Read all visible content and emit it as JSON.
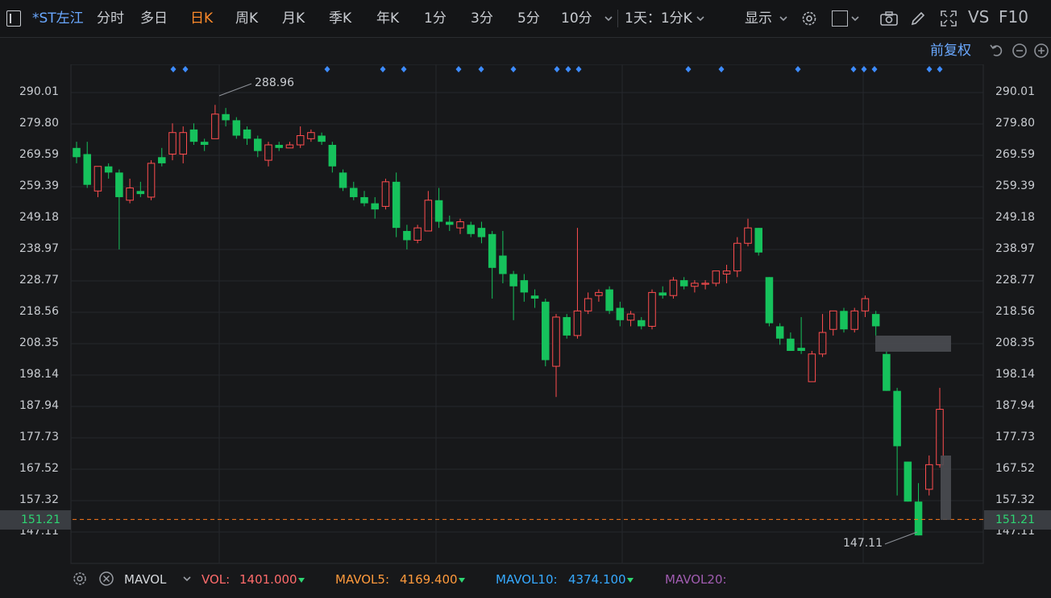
{
  "toolbar": {
    "stock_name": "*ST左江",
    "tabs": [
      "分时",
      "多日",
      "日K",
      "周K",
      "月K",
      "季K",
      "年K",
      "1分",
      "3分",
      "5分",
      "10分"
    ],
    "active_tab": "日K",
    "interval_select": "1天：1分K",
    "display_label": "显示",
    "vs_label": "VS",
    "f10_label": "F10"
  },
  "subbar": {
    "adjust_label": "前复权"
  },
  "price_axis": {
    "ticks": [
      "290.01",
      "279.80",
      "269.59",
      "259.39",
      "249.18",
      "238.97",
      "228.77",
      "218.56",
      "208.35",
      "198.14",
      "187.94",
      "177.73",
      "167.52",
      "157.32",
      "147.11"
    ],
    "current_price": "151.21",
    "high_label": "288.96",
    "low_label": "147.11"
  },
  "chart_data": {
    "type": "candlestick",
    "ylim": [
      147.11,
      290.01
    ],
    "current_price": 151.21,
    "max_annotation": 288.96,
    "min_annotation": 147.11,
    "up_color": "#ff4d4f",
    "down_color": "#16c25c",
    "candles": [
      {
        "o": 272,
        "c": 269,
        "h": 274,
        "l": 267
      },
      {
        "o": 270,
        "c": 260,
        "h": 274,
        "l": 259
      },
      {
        "o": 258,
        "c": 266,
        "h": 266,
        "l": 256
      },
      {
        "o": 266,
        "c": 264,
        "h": 267,
        "l": 262
      },
      {
        "o": 264,
        "c": 256,
        "h": 265,
        "l": 239
      },
      {
        "o": 255,
        "c": 259,
        "h": 262,
        "l": 254
      },
      {
        "o": 258,
        "c": 257,
        "h": 261,
        "l": 256
      },
      {
        "o": 256,
        "c": 267,
        "h": 268,
        "l": 255
      },
      {
        "o": 269,
        "c": 267,
        "h": 272,
        "l": 266
      },
      {
        "o": 270,
        "c": 277,
        "h": 280,
        "l": 268
      },
      {
        "o": 270,
        "c": 277,
        "h": 279,
        "l": 267
      },
      {
        "o": 278,
        "c": 274,
        "h": 280,
        "l": 273
      },
      {
        "o": 274,
        "c": 273,
        "h": 275,
        "l": 271
      },
      {
        "o": 275,
        "c": 283,
        "h": 286,
        "l": 275
      },
      {
        "o": 283,
        "c": 281,
        "h": 285,
        "l": 279
      },
      {
        "o": 281,
        "c": 276,
        "h": 282,
        "l": 275
      },
      {
        "o": 278,
        "c": 275,
        "h": 279,
        "l": 273
      },
      {
        "o": 275,
        "c": 271,
        "h": 276,
        "l": 269
      },
      {
        "o": 268,
        "c": 273,
        "h": 274,
        "l": 266
      },
      {
        "o": 273,
        "c": 272,
        "h": 274,
        "l": 271
      },
      {
        "o": 272,
        "c": 273,
        "h": 274,
        "l": 272
      },
      {
        "o": 273,
        "c": 276,
        "h": 279,
        "l": 272
      },
      {
        "o": 275,
        "c": 277,
        "h": 278,
        "l": 274
      },
      {
        "o": 276,
        "c": 274,
        "h": 277,
        "l": 273
      },
      {
        "o": 273,
        "c": 266,
        "h": 274,
        "l": 264
      },
      {
        "o": 264,
        "c": 259,
        "h": 265,
        "l": 258
      },
      {
        "o": 259,
        "c": 256,
        "h": 261,
        "l": 255
      },
      {
        "o": 256,
        "c": 254,
        "h": 258,
        "l": 253
      },
      {
        "o": 254,
        "c": 252,
        "h": 256,
        "l": 249
      },
      {
        "o": 253,
        "c": 261,
        "h": 262,
        "l": 252
      },
      {
        "o": 261,
        "c": 246,
        "h": 264,
        "l": 243
      },
      {
        "o": 245,
        "c": 242,
        "h": 247,
        "l": 239
      },
      {
        "o": 242,
        "c": 246,
        "h": 247,
        "l": 241
      },
      {
        "o": 245,
        "c": 255,
        "h": 258,
        "l": 245
      },
      {
        "o": 255,
        "c": 248,
        "h": 259,
        "l": 246
      },
      {
        "o": 248,
        "c": 247,
        "h": 250,
        "l": 245
      },
      {
        "o": 246,
        "c": 248,
        "h": 249,
        "l": 244
      },
      {
        "o": 247,
        "c": 244,
        "h": 248,
        "l": 243
      },
      {
        "o": 246,
        "c": 243,
        "h": 248,
        "l": 241
      },
      {
        "o": 244,
        "c": 233,
        "h": 245,
        "l": 223
      },
      {
        "o": 237,
        "c": 231,
        "h": 245,
        "l": 228
      },
      {
        "o": 231,
        "c": 227,
        "h": 232,
        "l": 216
      },
      {
        "o": 229,
        "c": 225,
        "h": 231,
        "l": 222
      },
      {
        "o": 224,
        "c": 223,
        "h": 226,
        "l": 220
      },
      {
        "o": 222,
        "c": 203,
        "h": 223,
        "l": 201
      },
      {
        "o": 201,
        "c": 217,
        "h": 218,
        "l": 191
      },
      {
        "o": 217,
        "c": 211,
        "h": 218,
        "l": 210
      },
      {
        "o": 211,
        "c": 219,
        "h": 246,
        "l": 210
      },
      {
        "o": 219,
        "c": 223,
        "h": 225,
        "l": 218
      },
      {
        "o": 224,
        "c": 225,
        "h": 226,
        "l": 222
      },
      {
        "o": 226,
        "c": 219,
        "h": 227,
        "l": 218
      },
      {
        "o": 220,
        "c": 216,
        "h": 222,
        "l": 214
      },
      {
        "o": 216,
        "c": 218,
        "h": 219,
        "l": 214
      },
      {
        "o": 216,
        "c": 214,
        "h": 217,
        "l": 213
      },
      {
        "o": 214,
        "c": 225,
        "h": 226,
        "l": 213
      },
      {
        "o": 225,
        "c": 224,
        "h": 227,
        "l": 223
      },
      {
        "o": 224,
        "c": 229,
        "h": 230,
        "l": 223
      },
      {
        "o": 229,
        "c": 227,
        "h": 230,
        "l": 226
      },
      {
        "o": 227,
        "c": 228,
        "h": 229,
        "l": 225
      },
      {
        "o": 228,
        "c": 228,
        "h": 229,
        "l": 226
      },
      {
        "o": 228,
        "c": 232,
        "h": 232,
        "l": 227
      },
      {
        "o": 231,
        "c": 232,
        "h": 234,
        "l": 228
      },
      {
        "o": 232,
        "c": 241,
        "h": 243,
        "l": 230
      },
      {
        "o": 241,
        "c": 246,
        "h": 249,
        "l": 240
      },
      {
        "o": 246,
        "c": 238,
        "h": 246,
        "l": 237
      },
      {
        "o": 230,
        "c": 215,
        "h": 230,
        "l": 214
      },
      {
        "o": 214,
        "c": 210,
        "h": 215,
        "l": 208
      },
      {
        "o": 210,
        "c": 206,
        "h": 212,
        "l": 206
      },
      {
        "o": 207,
        "c": 206,
        "h": 217,
        "l": 205
      },
      {
        "o": 196,
        "c": 205,
        "h": 206,
        "l": 196
      },
      {
        "o": 205,
        "c": 212,
        "h": 218,
        "l": 204
      },
      {
        "o": 213,
        "c": 219,
        "h": 219,
        "l": 211
      },
      {
        "o": 219,
        "c": 213,
        "h": 220,
        "l": 212
      },
      {
        "o": 213,
        "c": 219,
        "h": 220,
        "l": 212
      },
      {
        "o": 219,
        "c": 223,
        "h": 224,
        "l": 217
      },
      {
        "o": 218,
        "c": 214,
        "h": 219,
        "l": 211
      },
      {
        "o": 205,
        "c": 193,
        "h": 206,
        "l": 193
      },
      {
        "o": 193,
        "c": 175,
        "h": 194,
        "l": 159
      },
      {
        "o": 170,
        "c": 157,
        "h": 170,
        "l": 157
      },
      {
        "o": 157,
        "c": 146,
        "h": 163,
        "l": 146
      },
      {
        "o": 161,
        "c": 169,
        "h": 172,
        "l": 159
      },
      {
        "o": 169,
        "c": 187,
        "h": 194,
        "l": 168
      }
    ],
    "event_markers": [
      215,
      230,
      406,
      475,
      501,
      569,
      597,
      637,
      691,
      705,
      718,
      854,
      895,
      990,
      1059,
      1072,
      1085,
      1153,
      1166
    ],
    "volume": {
      "VOL": 1401.0,
      "MAVOL5": 4169.4,
      "MAVOL10": 4374.1
    }
  },
  "bottom_bar": {
    "indicator_label": "MAVOL",
    "vol_label": "VOL:",
    "vol_value": "1401.000",
    "mavol5_label": "MAVOL5:",
    "mavol5_value": "4169.400",
    "mavol10_label": "MAVOL10:",
    "mavol10_value": "4374.100",
    "mavol20_label": "MAVOL20:",
    "vol_color": "#ff6b6b",
    "mavol5_color": "#ff9a3c",
    "mavol10_color": "#36a9ff",
    "mavol20_color": "#a05cb0"
  }
}
